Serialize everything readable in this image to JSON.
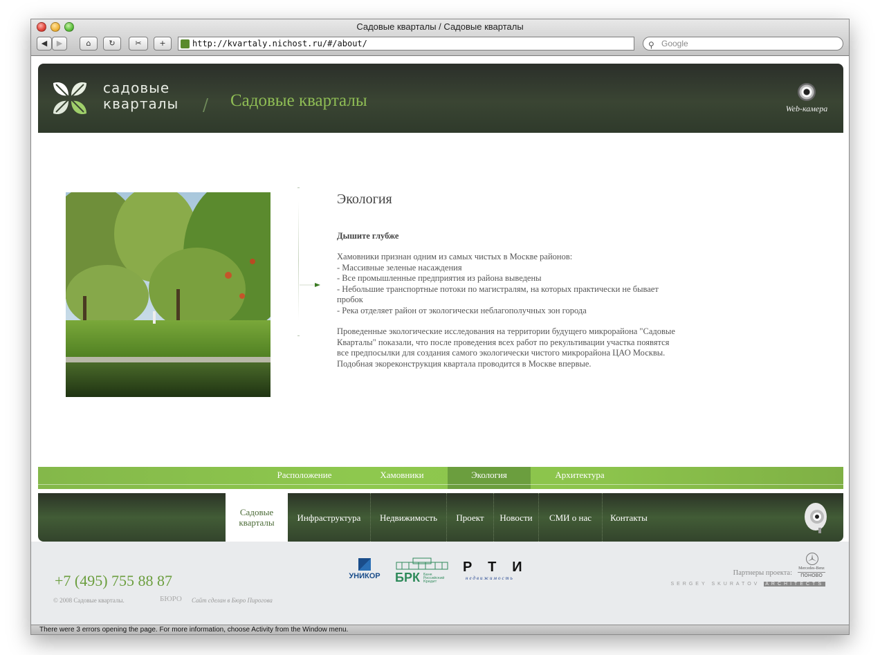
{
  "browser": {
    "title": "Садовые кварталы / Садовые кварталы",
    "url": "http://kvartaly.nichost.ru/#/about/",
    "search_placeholder": "Google",
    "status": "There were 3 errors opening the page. For more information, choose Activity from the Window menu."
  },
  "header": {
    "logo_line1": "садовые",
    "logo_line2": "кварталы",
    "slash": "/",
    "title": "Садовые кварталы",
    "webcam_label": "Web-камера"
  },
  "article": {
    "heading": "Экология",
    "subheading": "Дышите глубже",
    "intro": "Хамовники признан одним из самых чистых в Москве районов:",
    "bullets": [
      "- Массивные зеленые насаждения",
      "- Все промышленные предприятия из района выведены",
      "- Небольшие транспортные потоки по магистралям, на которых практически не бывает пробок",
      "- Река отделяет район от экологически неблагополучных зон города"
    ],
    "paragraph": "Проведенные экологические исследования на территории будущего микрорайона \"Садовые Кварталы\" показали, что после проведения всех работ по рекультивации участка появятся все предпосылки для создания самого экологически чистого микрорайона ЦАО Москвы. Подобная экореконструкция квартала проводится в Москве впервые."
  },
  "subnav": {
    "items": [
      "Расположение",
      "Хамовники",
      "Экология",
      "Архитектура"
    ],
    "active": "Экология"
  },
  "mainnav": {
    "items": [
      "Садовые кварталы",
      "Инфраструктура",
      "Недвижимость",
      "Проект",
      "Новости",
      "СМИ о нас",
      "Контакты"
    ],
    "active": "Садовые кварталы"
  },
  "footer": {
    "phone": "+7 (495) 755 88 87",
    "copyright": "© 2008 Садовые кварталы.",
    "buro": "БЮРО",
    "made_by": "Сайт сделан в Бюро Пирогова",
    "partners_label": "Партнеры проекта:",
    "unikor": "УНИКОР",
    "brk": "БРК",
    "brk_sub": "Банк Российский Кредит",
    "rti": "РТИ",
    "rti_sub": "недвижимость",
    "mercedes": "Mercedes-Benz",
    "ponovo": "ПОНОВО",
    "skuratov": "SERGEY SKURATOV",
    "architects": "ARCHITECTS"
  },
  "colors": {
    "accent_green": "#8ec84e",
    "dark_green": "#3a4533",
    "title_green": "#8fbd55"
  }
}
